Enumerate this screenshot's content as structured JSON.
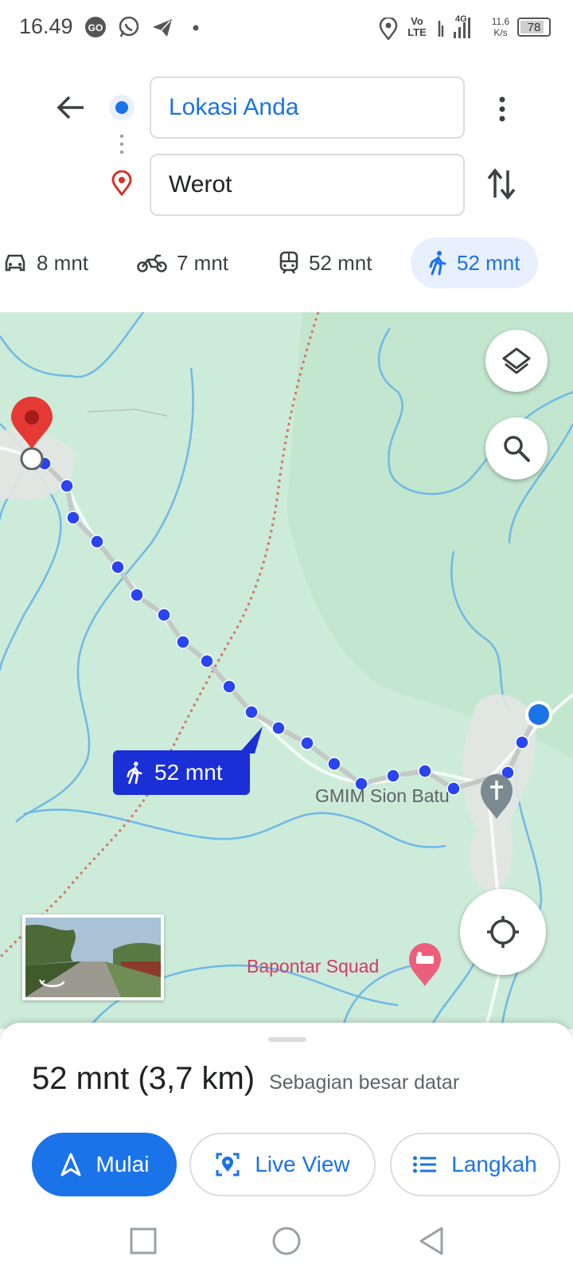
{
  "status_bar": {
    "time": "16.49",
    "speed_value": "11,6",
    "speed_unit": "K/s",
    "network": "4G",
    "volte_top": "Vo",
    "volte_bottom": "LTE",
    "battery": "78",
    "icons": [
      "gojek-icon",
      "whatsapp-icon",
      "telegram-icon",
      "dot-icon",
      "location-icon",
      "signal-icon",
      "battery-icon"
    ]
  },
  "directions": {
    "origin": "Lokasi Anda",
    "destination": "Werot"
  },
  "modes": [
    {
      "icon": "car-icon",
      "label": "8 mnt"
    },
    {
      "icon": "motorcycle-icon",
      "label": "7 mnt"
    },
    {
      "icon": "transit-icon",
      "label": "52 mnt"
    },
    {
      "icon": "walk-icon",
      "label": "52 mnt",
      "active": true
    }
  ],
  "map": {
    "route_badge": "52 mnt",
    "place_church": "GMIM Sion Batu",
    "place_lodging": "Bapontar Squad"
  },
  "sheet": {
    "duration": "52 mnt (3,7 km)",
    "terrain": "Sebagian besar datar",
    "start_button": "Mulai",
    "live_view_button": "Live View",
    "steps_button": "Langkah"
  },
  "colors": {
    "accent": "#1a73e8",
    "route_dot": "#2945f0",
    "map_green": "#cdebd9",
    "water": "#6fb9e8",
    "pin_red": "#e53935"
  }
}
